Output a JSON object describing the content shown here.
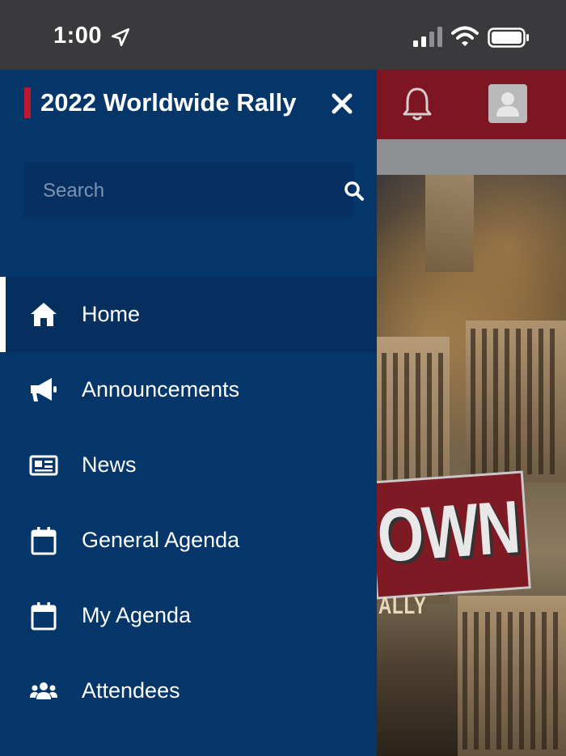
{
  "status_bar": {
    "time": "1:00"
  },
  "drawer": {
    "title": "2022 Worldwide Rally",
    "search": {
      "placeholder": "Search",
      "value": ""
    },
    "menu": [
      {
        "label": "Home",
        "icon": "home-icon",
        "active": true
      },
      {
        "label": "Announcements",
        "icon": "megaphone-icon",
        "active": false
      },
      {
        "label": "News",
        "icon": "newspaper-icon",
        "active": false
      },
      {
        "label": "General Agenda",
        "icon": "calendar-icon",
        "active": false
      },
      {
        "label": "My Agenda",
        "icon": "calendar-icon",
        "active": false
      },
      {
        "label": "Attendees",
        "icon": "users-icon",
        "active": false
      }
    ]
  },
  "background": {
    "banner_text": "OWN",
    "sub_text": "ALLY"
  },
  "colors": {
    "drawer_bg": "#05366a",
    "accent": "#c0172f",
    "header_bg": "#7d1522"
  }
}
